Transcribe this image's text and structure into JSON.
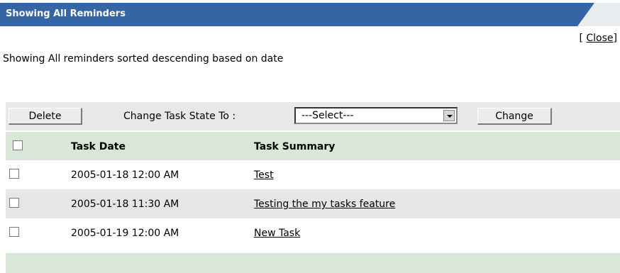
{
  "header": {
    "title": "Showing All Reminders"
  },
  "close": {
    "bracket_open": "[ ",
    "label": "Close",
    "bracket_close": "]"
  },
  "subtitle": "Showing All reminders sorted descending based on date",
  "toolbar": {
    "delete_label": "Delete",
    "state_label": "Change Task State To :",
    "select_value": "---Select---",
    "change_label": "Change"
  },
  "table": {
    "columns": [
      "Task Date",
      "Task Summary"
    ],
    "rows": [
      {
        "date": "2005-01-18 12:00 AM",
        "summary": "Test"
      },
      {
        "date": "2005-01-18 11:30 AM",
        "summary": "Testing the my tasks feature"
      },
      {
        "date": "2005-01-19 12:00 AM",
        "summary": "New Task"
      }
    ]
  },
  "colors": {
    "header_bar": "#3565a4",
    "table_header": "#d8e7d7",
    "alt_row": "#e6e6e6"
  }
}
